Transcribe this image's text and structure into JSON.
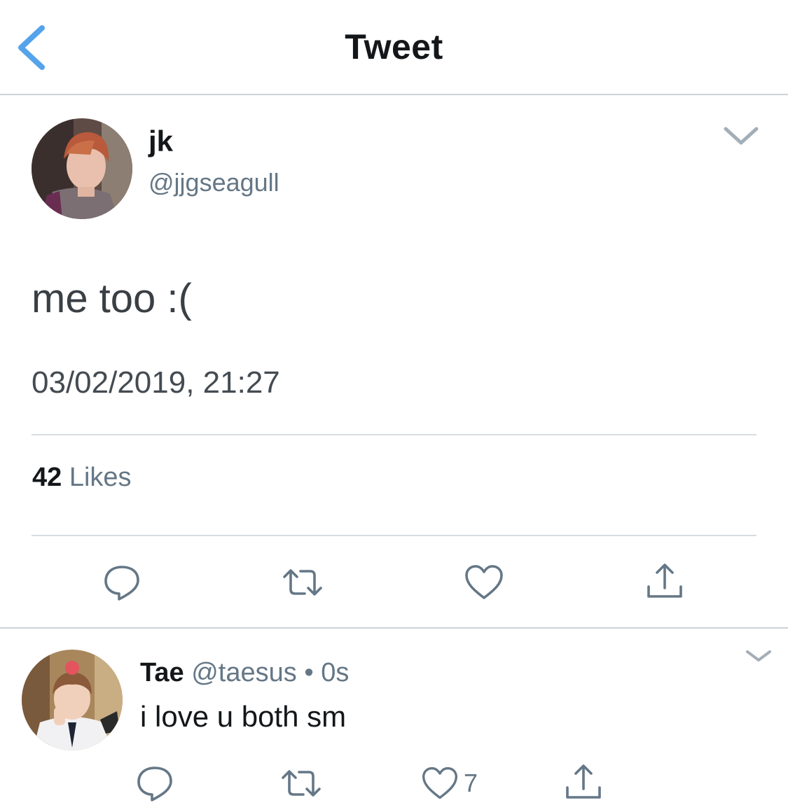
{
  "nav": {
    "title": "Tweet"
  },
  "tweet": {
    "display_name": "jk",
    "handle": "@jjgseagull",
    "text": "me too :(",
    "timestamp": "03/02/2019, 21:27",
    "likes_count": "42",
    "likes_label": "Likes"
  },
  "reply": {
    "display_name": "Tae",
    "handle": "@taesus",
    "separator": "•",
    "time": "0s",
    "text": "i love u both sm",
    "like_count": "7"
  },
  "colors": {
    "accent": "#55a3ea",
    "icon": "#657786",
    "text": "#14171a",
    "divider": "#d7dce0"
  },
  "icons": {
    "back": "chevron-left-icon",
    "more": "chevron-down-icon",
    "reply": "reply-icon",
    "retweet": "retweet-icon",
    "like": "heart-icon",
    "share": "share-icon"
  }
}
